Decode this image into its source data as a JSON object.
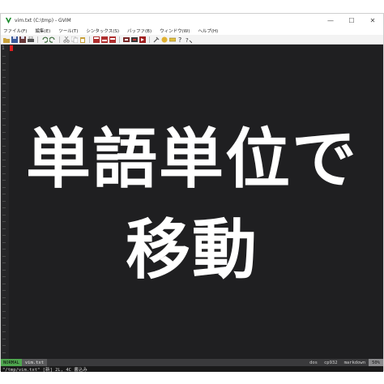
{
  "window": {
    "title": "vim.txt (C:\\tmp) - GVIM",
    "minimize_glyph": "—",
    "maximize_glyph": "☐",
    "close_glyph": "✕"
  },
  "menubar": {
    "items": [
      {
        "label": "ファイル(F)"
      },
      {
        "label": "編集(E)"
      },
      {
        "label": "ツール(T)"
      },
      {
        "label": "シンタックス(S)"
      },
      {
        "label": "バッファ(B)"
      },
      {
        "label": "ウィンドウ(W)"
      },
      {
        "label": "ヘルプ(H)"
      }
    ]
  },
  "editor": {
    "line_number": "1",
    "overlay_line1": "単語単位で",
    "overlay_line2": "移動",
    "background": "#1f1f21"
  },
  "statusline": {
    "mode": "NORMAL",
    "file": "vim.txt",
    "format": "dos",
    "encoding": "cp932",
    "filetype": "markdown",
    "position": "50%",
    "mode_color": "#4ea54e"
  },
  "cmdline": {
    "text": "\"/tmp/vim.txt\" [新] 2L, 4C 書込み"
  },
  "icons": {
    "app": "gvim-logo-icon",
    "toolbar": [
      "open-file-icon",
      "save-icon",
      "save-all-icon",
      "print-icon",
      "undo-icon",
      "redo-icon",
      "cut-icon",
      "copy-icon",
      "paste-icon",
      "find-icon",
      "find-next-icon",
      "find-prev-icon",
      "load-session-icon",
      "save-session-icon",
      "run-script-icon",
      "make-icon",
      "run-ctags-icon",
      "tag-jump-icon",
      "help-icon",
      "find-help-icon"
    ]
  }
}
